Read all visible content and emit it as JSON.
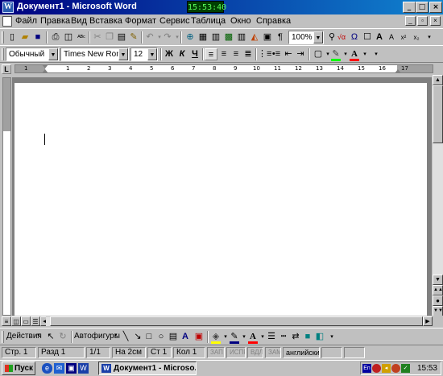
{
  "window": {
    "title": "Документ1 - Microsoft Word",
    "clock": "15:53:40",
    "controls": {
      "minimize": "_",
      "maximize": "□",
      "close": "×"
    }
  },
  "menu": {
    "items": [
      "Файл",
      "Правка",
      "Вид",
      "Вставка",
      "Формат",
      "Сервис",
      "Таблица",
      "Окно",
      "Справка"
    ]
  },
  "standard_toolbar": {
    "zoom": "100%",
    "zoom_options": [
      "100%"
    ]
  },
  "formatting_toolbar": {
    "style": "Обычный",
    "font": "Times New Roman",
    "size": "12",
    "bold": "Ж",
    "italic": "К",
    "underline": "Ч"
  },
  "ruler": {
    "numbers": [
      "1",
      "1",
      "2",
      "3",
      "4",
      "5",
      "6",
      "7",
      "8",
      "9",
      "10",
      "11",
      "12",
      "13",
      "14",
      "15",
      "16",
      "17"
    ],
    "tab_selector": "L"
  },
  "drawing_toolbar": {
    "actions": "Действия",
    "autoshapes": "Автофигуры"
  },
  "status": {
    "page": "Стр. 1",
    "section": "Разд 1",
    "pages": "1/1",
    "at": "На 2см",
    "line": "Ст 1",
    "col": "Кол 1",
    "rec": "ЗАП",
    "trk": "ИСПР",
    "ext": "ВДЛ",
    "ovr": "ЗАМ",
    "language": "английский"
  },
  "taskbar": {
    "start": "Пуск",
    "task": "Документ1 - Microso...",
    "lang": "En",
    "time": "15:53"
  },
  "colors": {
    "title_bar": "#000080",
    "highlight": "#00ff00",
    "font_color": "#ff0000"
  }
}
